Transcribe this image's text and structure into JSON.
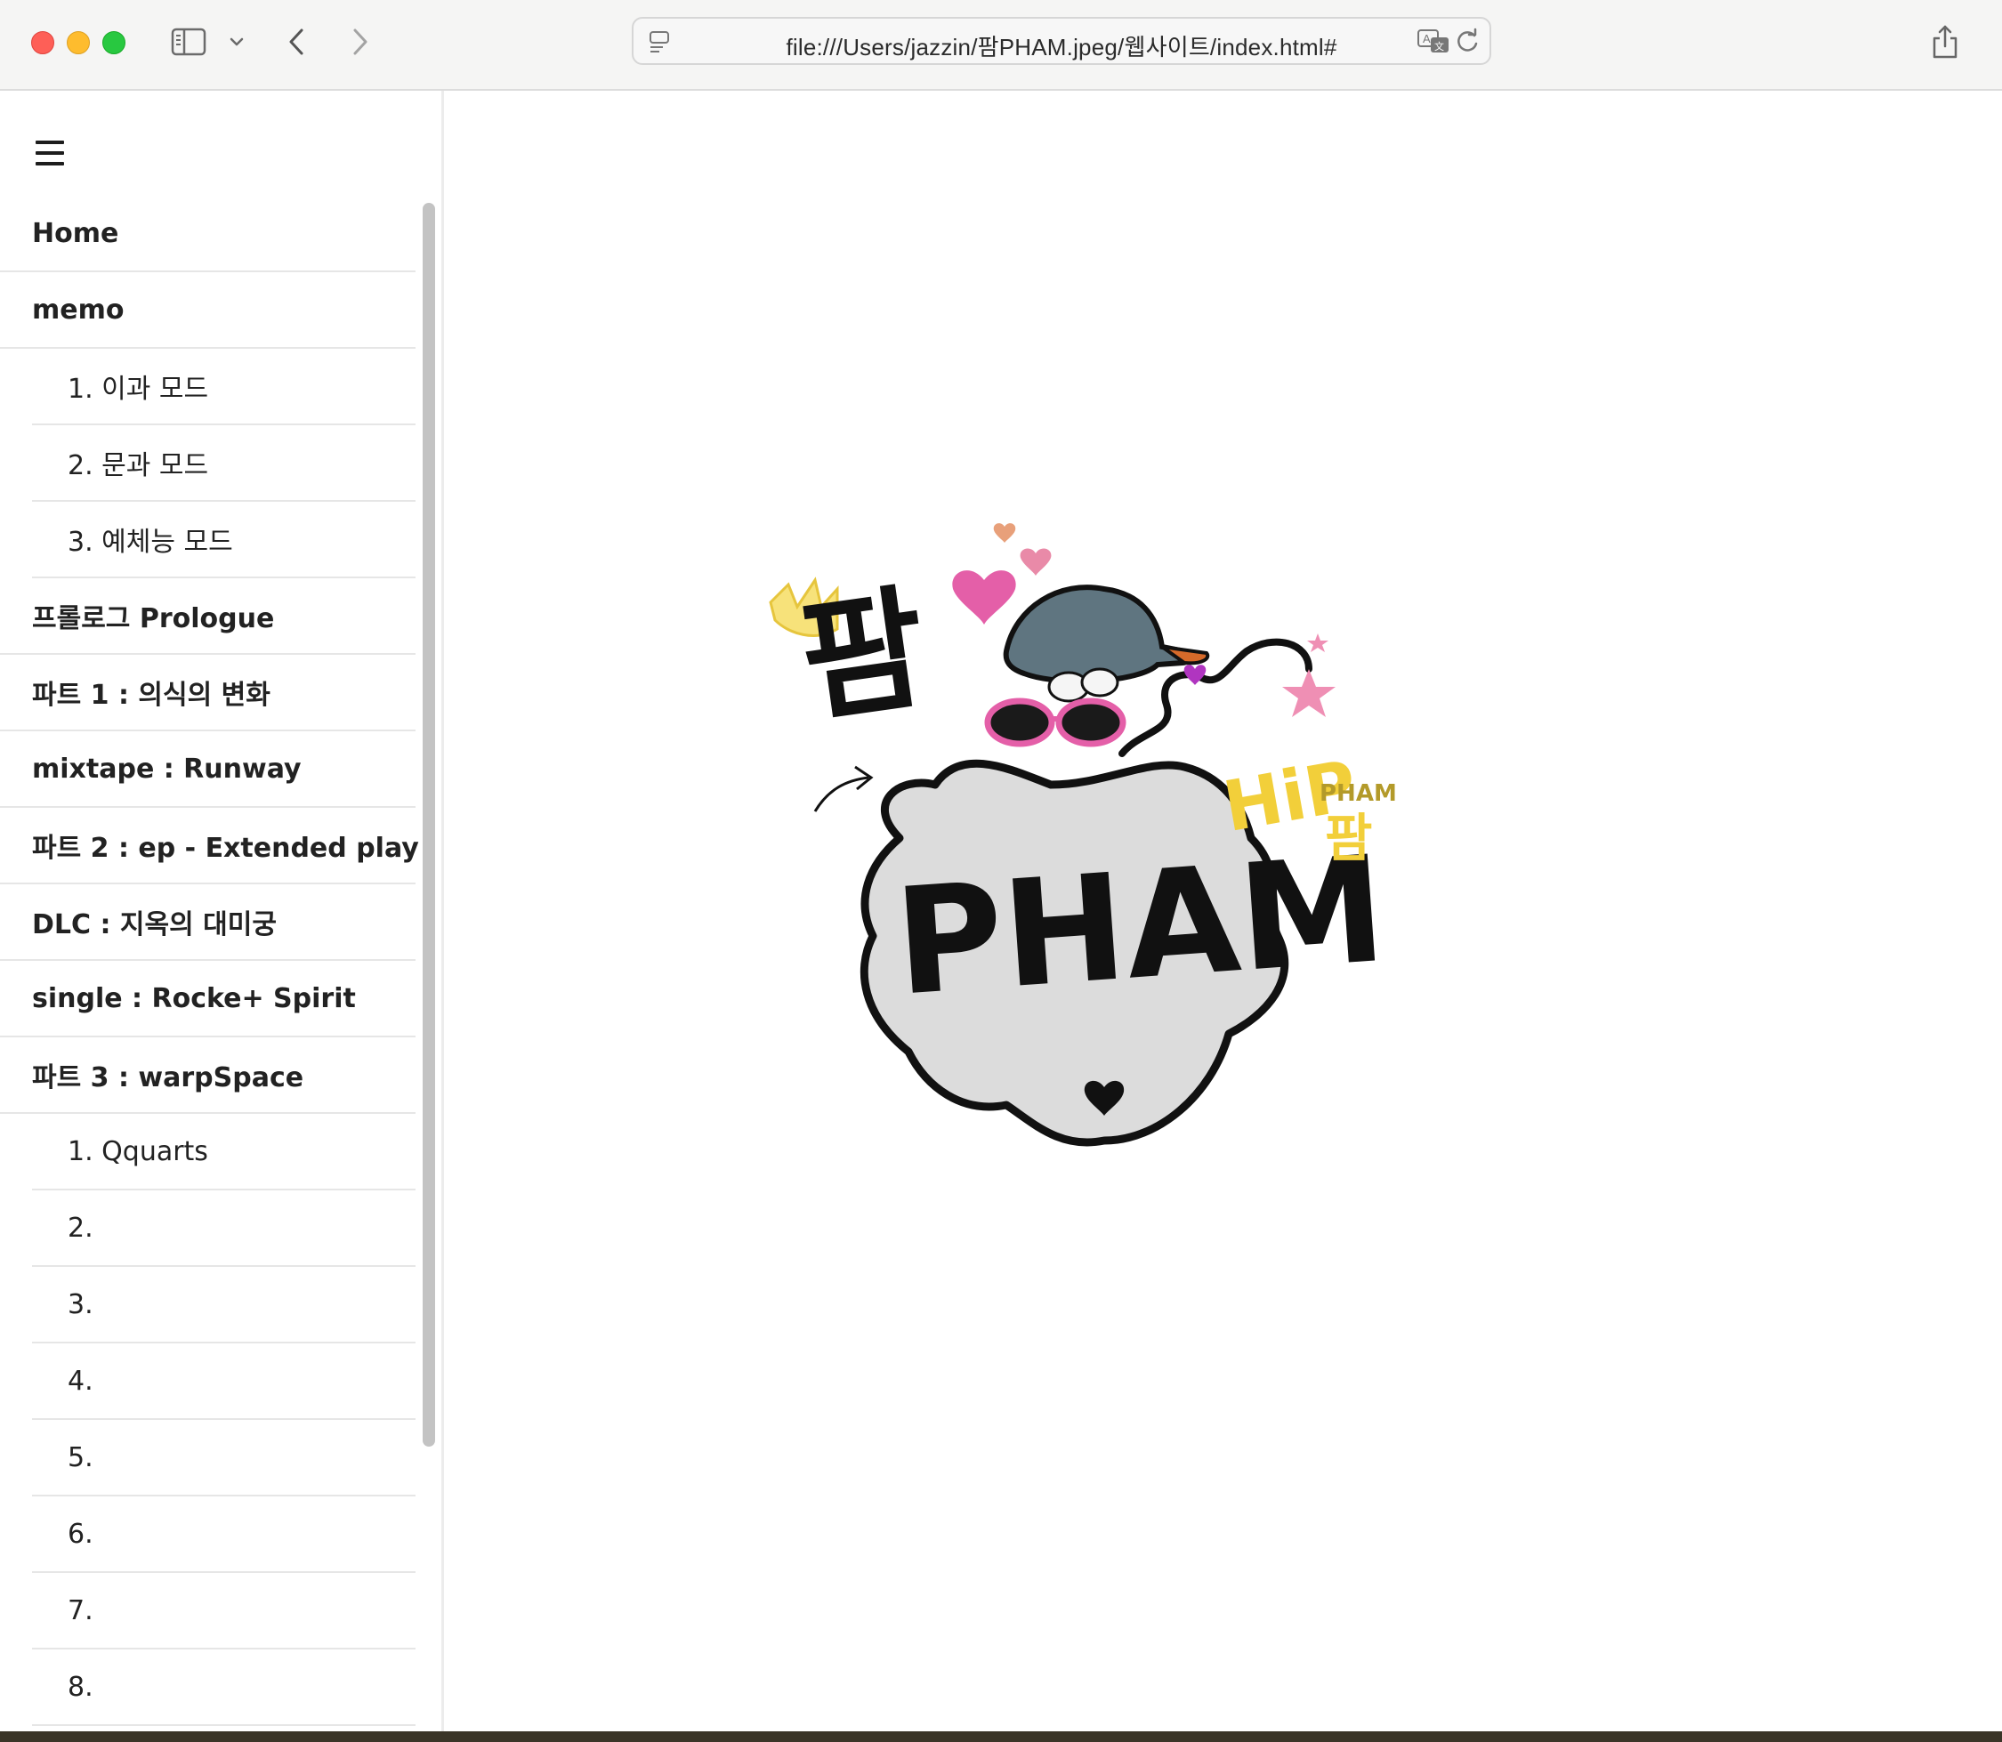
{
  "browser": {
    "url": "file:///Users/jazzin/팜PHAM.jpeg/웹사이트/index.html#",
    "icons": {
      "sidebar_toggle": "sidebar-icon",
      "sidebar_menu": "chevron-down-icon",
      "back": "chevron-left-icon",
      "forward": "chevron-right-icon",
      "page_info": "page-icon",
      "translate": "translate-icon",
      "reload": "reload-icon",
      "share": "share-icon"
    }
  },
  "sidebar": {
    "menu_icon": "hamburger-menu-icon",
    "items": [
      {
        "label": "Home",
        "level": "top"
      },
      {
        "label": "memo",
        "level": "top"
      },
      {
        "label": "1. 이과 모드",
        "level": "sub"
      },
      {
        "label": "2. 문과 모드",
        "level": "sub"
      },
      {
        "label": "3. 예체능 모드",
        "level": "sub"
      },
      {
        "label": "프롤로그 Prologue",
        "level": "top"
      },
      {
        "label": "파트 1 : 의식의 변화",
        "level": "top"
      },
      {
        "label": "mixtape : Runway",
        "level": "top"
      },
      {
        "label": "파트 2 : ep - Extended play",
        "level": "top"
      },
      {
        "label": "DLC : 지옥의 대미궁",
        "level": "top"
      },
      {
        "label": "single : Rocke+ Spirit",
        "level": "top"
      },
      {
        "label": "파트 3 : warpSpace",
        "level": "top"
      },
      {
        "label": "1. Qquarts",
        "level": "sub"
      },
      {
        "label": "2.",
        "level": "sub"
      },
      {
        "label": "3.",
        "level": "sub"
      },
      {
        "label": "4.",
        "level": "sub"
      },
      {
        "label": "5.",
        "level": "sub"
      },
      {
        "label": "6.",
        "level": "sub"
      },
      {
        "label": "7.",
        "level": "sub"
      },
      {
        "label": "8.",
        "level": "sub"
      }
    ]
  },
  "main": {
    "logo": {
      "text_main": "PHAM",
      "text_korean": "팜",
      "text_hip": "HiP",
      "text_small": "PHAM",
      "text_small_korean": "팜"
    }
  },
  "colors": {
    "logo_yellow": "#f2cf3a",
    "logo_pink": "#e45fa8",
    "logo_gray": "#dcdcdc",
    "cap_gray": "#5f7580"
  }
}
